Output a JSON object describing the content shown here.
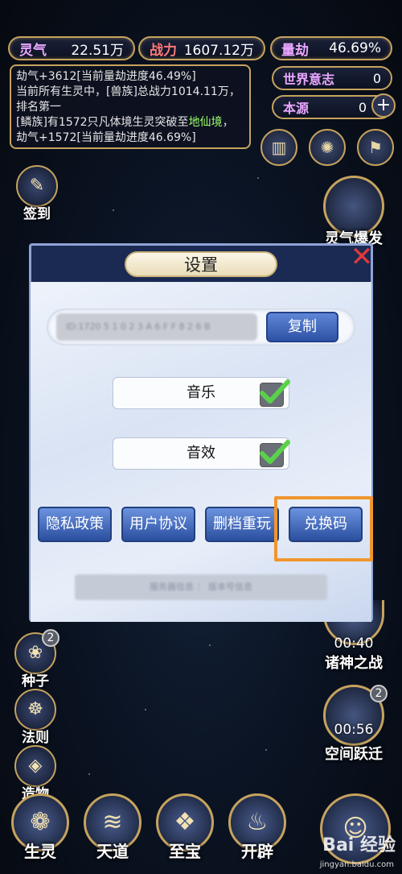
{
  "resources": {
    "lingqi": {
      "label": "灵气",
      "value": "22.51万"
    },
    "zhanli": {
      "label": "战力",
      "value": "1607.12万"
    },
    "liangjie": {
      "label": "量劫",
      "value": "46.69%"
    },
    "world_will": {
      "label": "世界意志",
      "value": "0"
    },
    "source": {
      "label": "本源",
      "value": "0"
    }
  },
  "log": {
    "line1": "劫气+3612[当前量劫进度46.49%]",
    "line2": "当前所有生灵中，[兽族]总战力1014.11万，排名第一",
    "line3a": "[鳞族]有1572只凡体境生灵突破至",
    "line3b": "地仙境",
    "line3c": "，劫气+1572[当前量劫进度46.69%]"
  },
  "left_buttons": {
    "signin": "签到",
    "seed": "种子",
    "seed_badge": "2",
    "law": "法则",
    "creation": "造物"
  },
  "right_buttons": {
    "lingqi_burst": "灵气爆发",
    "gods_war": "诸神之战",
    "gods_timer": "00:40",
    "space_jump": "空间跃迁",
    "space_timer": "00:56",
    "space_badge": "2"
  },
  "bottom_nav": [
    "生灵",
    "天道",
    "至宝",
    "开辟"
  ],
  "dialog": {
    "title": "设置",
    "id_value": "ID:1720 5 1 0 2 3 A 6 F F 8 2 6 B",
    "copy_label": "复制",
    "music_label": "音乐",
    "music_on": true,
    "sfx_label": "音效",
    "sfx_on": true,
    "buttons": {
      "privacy": "隐私政策",
      "agreement": "用户协议",
      "delete_save": "删档重玩",
      "redeem": "兑换码"
    },
    "version_info": "服务器信息 ： 版本号信息"
  },
  "watermark": {
    "brand": "Bai 经验",
    "url": "jingyan.baidu.com"
  },
  "colors": {
    "highlight": "#f0962e",
    "gold": "#c6a35e",
    "button_blue": "#3a62b8"
  }
}
